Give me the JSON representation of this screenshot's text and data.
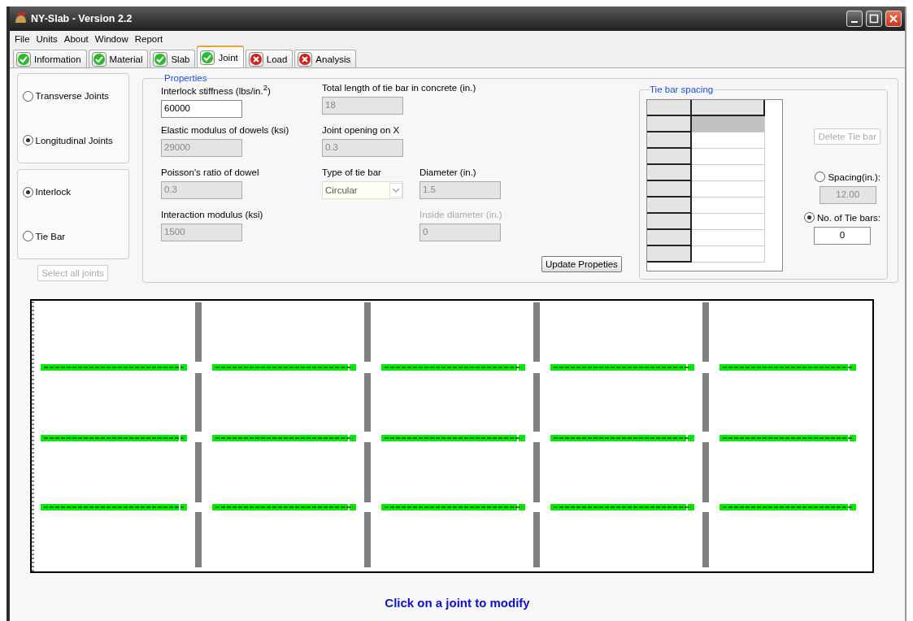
{
  "window": {
    "title": "NY-Slab - Version 2.2"
  },
  "menu": [
    "File",
    "Units",
    "About",
    "Window",
    "Report"
  ],
  "tabs": [
    {
      "label": "Information",
      "kind": "ok",
      "selected": false
    },
    {
      "label": "Material",
      "kind": "ok",
      "selected": false
    },
    {
      "label": "Slab",
      "kind": "ok",
      "selected": false
    },
    {
      "label": "Joint",
      "kind": "ok",
      "selected": true
    },
    {
      "label": "Load",
      "kind": "error",
      "selected": false
    },
    {
      "label": "Analysis",
      "kind": "error",
      "selected": false
    }
  ],
  "joint_direction": [
    {
      "label": "Transverse Joints",
      "selected": false
    },
    {
      "label": "Longitudinal Joints",
      "selected": true
    }
  ],
  "joint_type": [
    {
      "label": "Interlock",
      "selected": true
    },
    {
      "label": "Tie Bar",
      "selected": false
    }
  ],
  "select_all_button": {
    "label": "Select all joints",
    "disabled": true
  },
  "properties": {
    "title": "Properties",
    "columns": [
      {
        "fields": [
          {
            "label": "Interlock stiffness (lbs/in.$^{2}$)",
            "value": "60000",
            "kind": "input",
            "disabled": false
          },
          {
            "label": "Elastic modulus of dowels (ksi)",
            "value": "29000",
            "kind": "input",
            "disabled": true
          },
          {
            "label": "Poisson's ratio of dowel",
            "value": "0.3",
            "kind": "input",
            "disabled": true
          },
          {
            "label": "Interaction modulus (ksi)",
            "value": "1500",
            "kind": "input",
            "disabled": true
          }
        ]
      },
      {
        "fields": [
          {
            "label": "Total length of tie bar in concrete (in.)",
            "value": "18",
            "kind": "input",
            "disabled": true
          },
          {
            "label": "Joint opening on X",
            "value": "0.3",
            "kind": "input",
            "disabled": true
          },
          {
            "label": "Type of tie bar",
            "value": "Circular",
            "kind": "dropdown",
            "disabled": true
          }
        ]
      },
      {
        "fields": [
          {
            "label": "Diameter (in.)",
            "value": "1.5",
            "kind": "input",
            "disabled": true
          },
          {
            "label": "Inside diameter (in.)",
            "value": "0",
            "kind": "input",
            "disabled": true,
            "label_disabled": true
          }
        ]
      }
    ],
    "update_button": {
      "label": "Update Propeties",
      "disabled": false
    }
  },
  "tie_bar_spacing": {
    "title": "Tie bar spacing",
    "rows": [
      {
        "selected": true
      },
      {
        "selected": false
      },
      {
        "selected": false
      },
      {
        "selected": false
      },
      {
        "selected": false
      },
      {
        "selected": false
      },
      {
        "selected": false
      },
      {
        "selected": false
      },
      {
        "selected": false
      }
    ],
    "delete_button": {
      "label": "Delete Tie bar",
      "disabled": true
    },
    "options": [
      {
        "label": "Spacing(in.):",
        "selected": false,
        "value": "12.00",
        "disabled": true
      },
      {
        "label": "No. of Tie bars:",
        "selected": true,
        "value": "0",
        "disabled": false
      }
    ]
  },
  "hint": "Click on a joint to modify"
}
